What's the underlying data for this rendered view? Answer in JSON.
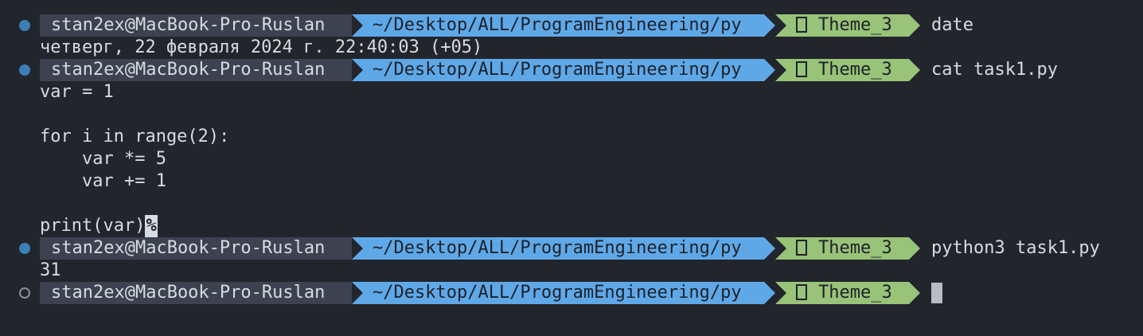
{
  "prompt": {
    "user_host": "stan2ex@MacBook-Pro-Ruslan",
    "path": "~/Desktop/ALL/ProgramEngineering/py",
    "branch": "Theme_3",
    "branch_icon": "git-branch-icon"
  },
  "commands": [
    {
      "text": "date"
    },
    {
      "text": "cat task1.py"
    },
    {
      "text": "python3 task1.py"
    },
    {
      "text": ""
    }
  ],
  "output": {
    "date": "четверг, 22 февраля 2024 г. 22:40:03 (+05)",
    "code_lines": [
      "var = 1",
      "",
      "for i in range(2):",
      "    var *= 5",
      "    var += 1",
      "",
      "print(var)"
    ],
    "eof_marker": "%",
    "result": "31"
  },
  "colors": {
    "background": "#22252c",
    "user_segment": "#3d4250",
    "path_segment": "#5fa8e8",
    "git_segment": "#98c379",
    "done_mark": "#3b7fb6"
  }
}
